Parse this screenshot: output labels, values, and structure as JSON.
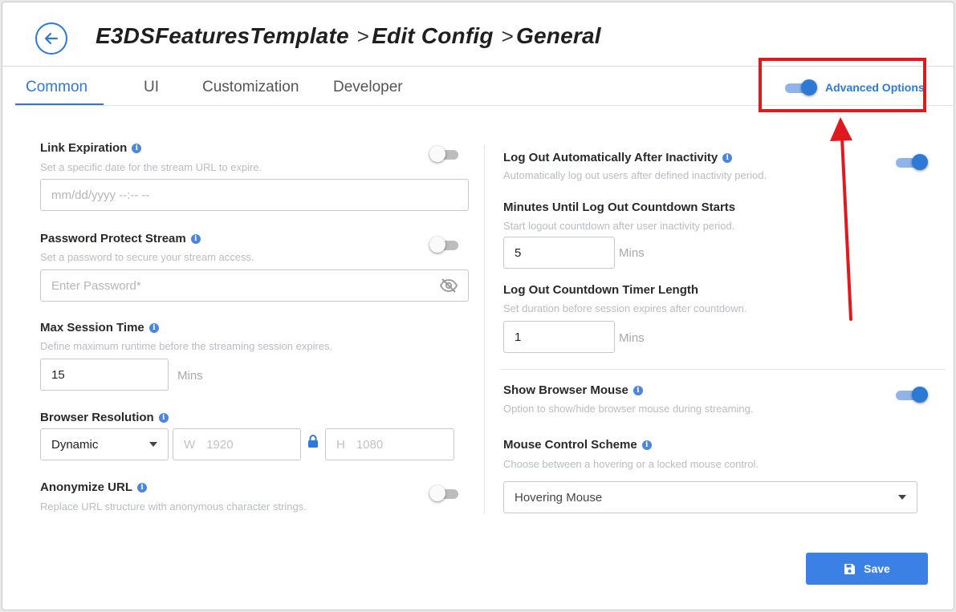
{
  "header": {
    "crumbs": [
      "E3DSFeaturesTemplate",
      "Edit Config",
      "General"
    ],
    "separator": ">"
  },
  "tabs": [
    {
      "label": "Common",
      "active": true
    },
    {
      "label": "UI",
      "active": false
    },
    {
      "label": "Customization",
      "active": false
    },
    {
      "label": "Developer",
      "active": false
    }
  ],
  "advanced_options": {
    "label": "Advanced Options",
    "enabled": true
  },
  "left": {
    "link_expiration": {
      "label": "Link Expiration",
      "hint": "Set a specific date for the stream URL to expire.",
      "enabled": false,
      "placeholder": "mm/dd/yyyy --:-- --"
    },
    "password_protect": {
      "label": "Password Protect Stream",
      "hint": "Set a password to secure your stream access.",
      "enabled": false,
      "placeholder": "Enter Password*"
    },
    "max_session": {
      "label": "Max Session Time",
      "hint": "Define maximum runtime before the streaming session expires.",
      "value": "15",
      "unit": "Mins"
    },
    "browser_resolution": {
      "label": "Browser Resolution",
      "mode": "Dynamic",
      "w_prefix": "W",
      "width": "1920",
      "h_prefix": "H",
      "height": "1080"
    },
    "anonymize_url": {
      "label": "Anonymize URL",
      "hint": "Replace URL structure with anonymous character strings.",
      "enabled": false
    }
  },
  "right": {
    "auto_logout": {
      "label": "Log Out Automatically After Inactivity",
      "hint": "Automatically log out users after defined inactivity period.",
      "enabled": true
    },
    "minutes_until": {
      "label": "Minutes Until Log Out Countdown Starts",
      "hint": "Start logout countdown after user inactivity period.",
      "value": "5",
      "unit": "Mins"
    },
    "countdown_length": {
      "label": "Log Out Countdown Timer Length",
      "hint": "Set duration before session expires after countdown.",
      "value": "1",
      "unit": "Mins"
    },
    "show_mouse": {
      "label": "Show Browser Mouse",
      "hint": "Option to show/hide browser mouse during streaming.",
      "enabled": true
    },
    "mouse_scheme": {
      "label": "Mouse Control Scheme",
      "hint": "Choose between a hovering or a locked mouse control.",
      "value": "Hovering Mouse"
    }
  },
  "footer": {
    "save_label": "Save"
  },
  "colors": {
    "accent": "#2d7ad6",
    "annotation": "#e0191e"
  }
}
